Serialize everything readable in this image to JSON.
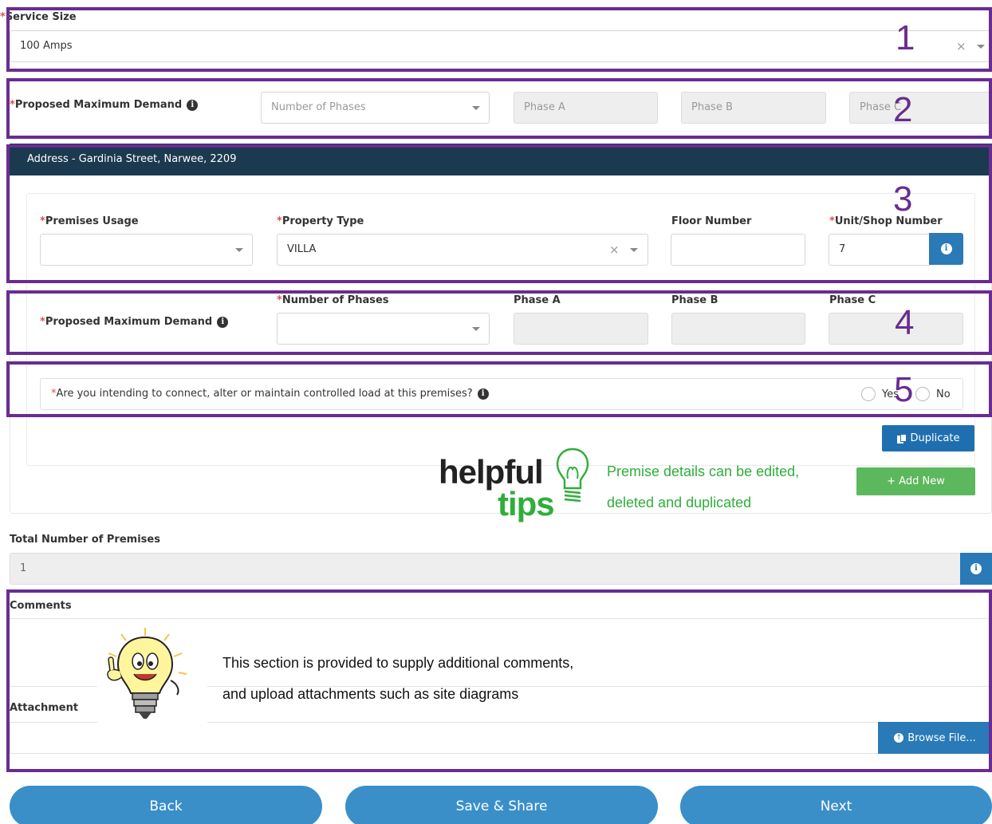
{
  "service_size": {
    "label": "Service Size",
    "value": "100 Amps"
  },
  "pmd_top": {
    "label": "Proposed Maximum Demand",
    "phases_placeholder": "Number of Phases",
    "phase_a_placeholder": "Phase A",
    "phase_b_placeholder": "Phase B",
    "phase_c_placeholder": "Phase C"
  },
  "address_bar": "Address - Gardinia Street, Narwee, 2209",
  "premises": {
    "usage_label": "Premises Usage",
    "usage_value": "",
    "property_type_label": "Property Type",
    "property_type_value": "VILLA",
    "floor_label": "Floor Number",
    "floor_value": "",
    "unit_label": "Unit/Shop Number",
    "unit_value": "7"
  },
  "pmd_premise": {
    "label": "Proposed Maximum Demand",
    "phases_label": "Number of Phases",
    "phase_a_label": "Phase A",
    "phase_b_label": "Phase B",
    "phase_c_label": "Phase C"
  },
  "controlled_load": {
    "question": "Are you intending to connect, alter or maintain controlled load at this premises?",
    "yes_label": "Yes",
    "no_label": "No"
  },
  "buttons": {
    "duplicate": "Duplicate",
    "add_new": "+ Add New",
    "browse": "Browse File...",
    "back": "Back",
    "save_share": "Save & Share",
    "next": "Next"
  },
  "helpful_tips": {
    "logo_word_1": "helpful",
    "logo_word_2": "tips",
    "line1": "Premise details can be edited,",
    "line2": "deleted and duplicated"
  },
  "total_premises": {
    "label": "Total Number of Premises",
    "value": "1"
  },
  "comments_label": "Comments",
  "attachment_label": "Attachment",
  "comment_note": {
    "line1": "This section is provided to supply additional comments,",
    "line2": "and upload attachments such as site diagrams"
  },
  "callout_numbers": [
    "1",
    "2",
    "3",
    "4",
    "5"
  ],
  "colors": {
    "frame_purple": "#6a2c91",
    "header_navy": "#1b3a4f",
    "primary_blue": "#1f6fb0",
    "pill_blue": "#3a8fc9",
    "success_green": "#5cb85c",
    "tip_green": "#2fae3a",
    "required_red": "#d9534f"
  }
}
